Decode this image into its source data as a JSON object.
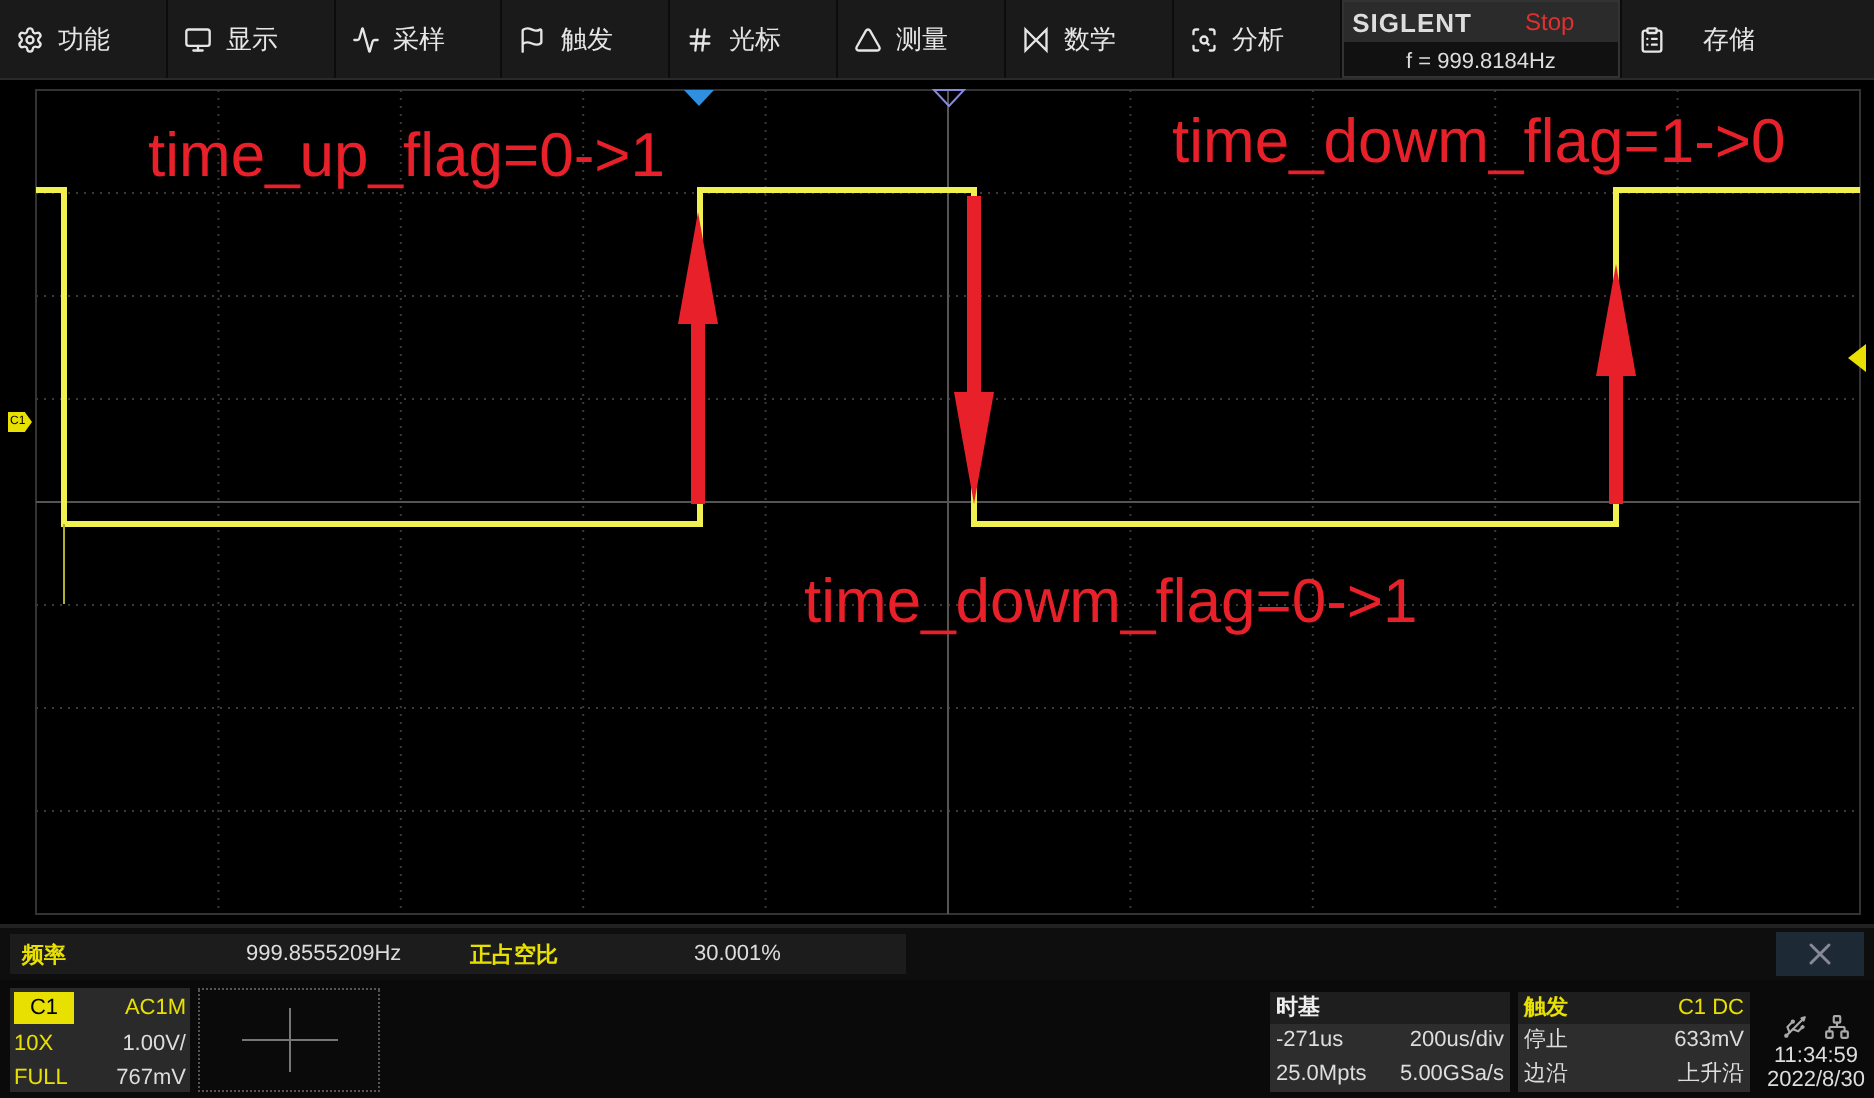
{
  "toolbar": {
    "menus": [
      {
        "label": "功能"
      },
      {
        "label": "显示"
      },
      {
        "label": "采样"
      },
      {
        "label": "触发"
      },
      {
        "label": "光标"
      },
      {
        "label": "测量"
      },
      {
        "label": "数学"
      },
      {
        "label": "分析"
      }
    ],
    "brand": "SIGLENT",
    "run_state": "Stop",
    "frequency": "f = 999.8184Hz",
    "storage": "存储"
  },
  "scope": {
    "channel_marker": "C1",
    "annotations": [
      {
        "text": "time_up_flag=0->1"
      },
      {
        "text": "time_dowm_flag=1->0"
      },
      {
        "text": "time_dowm_flag=0->1"
      }
    ]
  },
  "measurements": [
    {
      "label": "频率",
      "value": "999.8555209Hz"
    },
    {
      "label": "正占空比",
      "value": "30.001%"
    }
  ],
  "channel": {
    "name": "C1",
    "coupling": "AC1M",
    "probe": "10X",
    "scale": "1.00V/",
    "bandwidth": "FULL",
    "offset": "767mV"
  },
  "timebase": {
    "title": "时基",
    "delay": "-271us",
    "scale": "200us/div",
    "memory": "25.0Mpts",
    "sample_rate": "5.00GSa/s"
  },
  "trigger": {
    "title": "触发",
    "source": "C1 DC",
    "mode": "停止",
    "level": "633mV",
    "type": "边沿",
    "slope": "上升沿"
  },
  "status": {
    "time": "11:34:59",
    "date": "2022/8/30"
  }
}
